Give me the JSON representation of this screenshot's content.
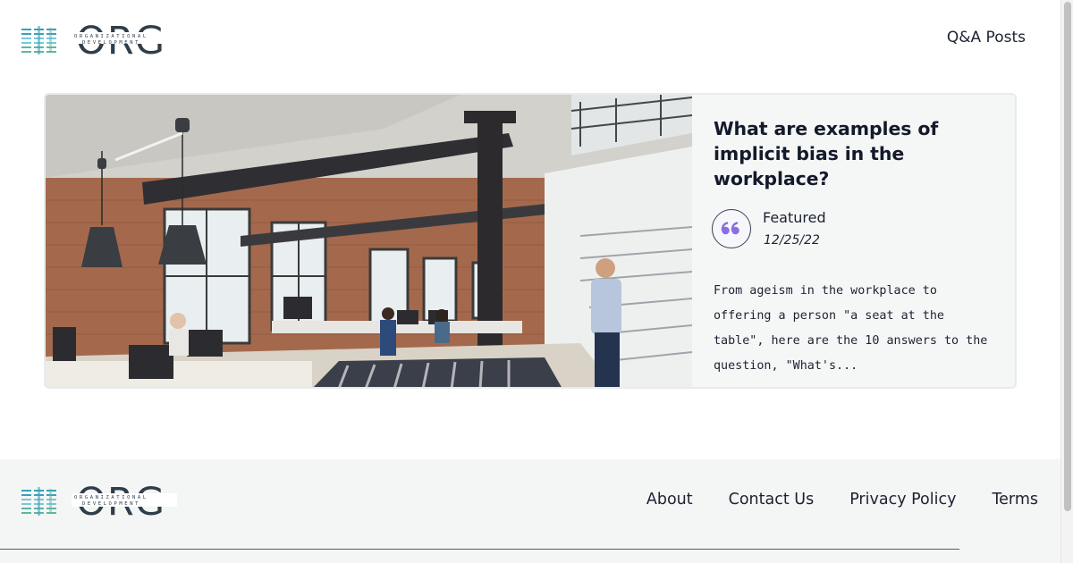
{
  "header": {
    "logo_text": "ORG",
    "logo_tagline_1": "ORGANIZATIONAL",
    "logo_tagline_2": "DEVELOPMENT",
    "nav_label": "Q&A Posts"
  },
  "card": {
    "image_name": "open-plan-office-photo",
    "title": "What are examples of implicit bias in the workplace?",
    "avatar_icon": "quote-icon",
    "author": "Featured",
    "date": "12/25/22",
    "excerpt": "From ageism in the workplace to offering a person \"a seat at the table\", here are the 10 answers to the question, \"What's..."
  },
  "footer": {
    "links": [
      "About",
      "Contact Us",
      "Privacy Policy",
      "Terms"
    ]
  },
  "colors": {
    "logo_bars": [
      "#3aa0b8",
      "#5fb6a0",
      "#7bc7d9"
    ],
    "logo_letters": "#2f3e4a",
    "accent_quote": "#8a6ee0",
    "footer_bg": "#f4f6f6",
    "card_bg": "#f5f7f7"
  }
}
